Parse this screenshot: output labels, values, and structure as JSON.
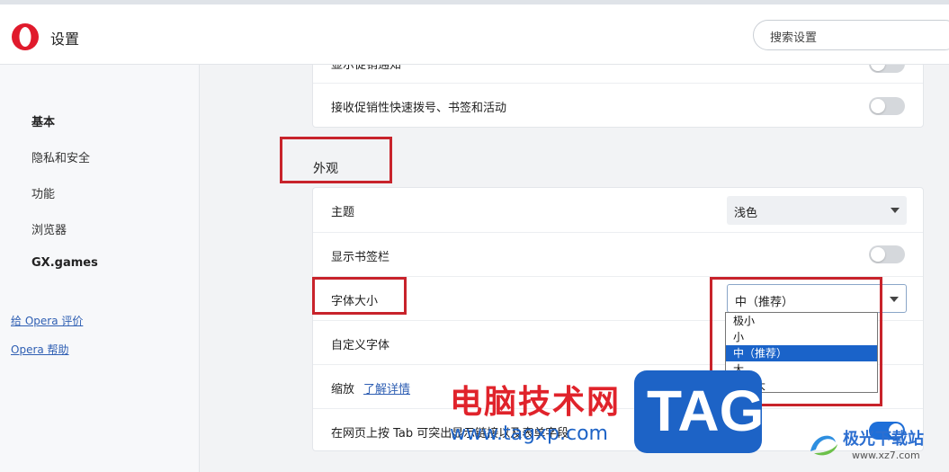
{
  "header": {
    "title": "设置",
    "search_placeholder": "搜索设置"
  },
  "sidebar": {
    "items": [
      {
        "label": "基本"
      },
      {
        "label": "隐私和安全"
      },
      {
        "label": "功能"
      },
      {
        "label": "浏览器"
      },
      {
        "label": "GX.games"
      }
    ],
    "links": [
      {
        "label": "给 Opera 评价"
      },
      {
        "label": "Opera 帮助"
      }
    ]
  },
  "top_card": {
    "rows": [
      {
        "label": "显示促销通知",
        "toggle": false
      },
      {
        "label": "接收促销性快速拨号、书签和活动",
        "toggle": false
      }
    ]
  },
  "appearance": {
    "title": "外观",
    "theme_label": "主题",
    "theme_value": "浅色",
    "bookmarks_bar_label": "显示书签栏",
    "bookmarks_bar_on": false,
    "font_size_label": "字体大小",
    "font_size_value": "中（推荐）",
    "font_size_options": [
      "极小",
      "小",
      "中（推荐）",
      "大",
      "非常大"
    ],
    "font_size_selected_index": 2,
    "custom_font_label": "自定义字体",
    "zoom_label": "缩放",
    "zoom_link": "了解详情",
    "tab_cycle_label": "在网页上按 Tab 可突出显示链接以及表单字段",
    "tab_cycle_on": true
  },
  "watermark": {
    "cn_text": "电脑技术网",
    "url_text": "www.tagxp.com",
    "tag_text": "TAG",
    "site2_text": "极光下载站",
    "site2_url": "www.xz7.com"
  },
  "colors": {
    "accent": "#1e6fd9",
    "highlight_box": "#c8232b",
    "watermark_red": "#e0232b",
    "watermark_blue": "#1d63c6"
  }
}
